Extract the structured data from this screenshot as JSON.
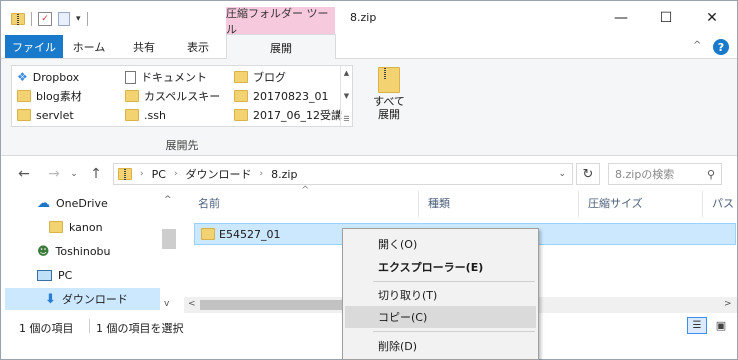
{
  "window": {
    "title": "8.zip",
    "context_tab_header": "圧縮フォルダー ツール",
    "controls": {
      "minimize": "—",
      "maximize": "☐",
      "close": "✕"
    }
  },
  "ribbon_tabs": {
    "file": "ファイル",
    "home": "ホーム",
    "share": "共有",
    "view": "表示",
    "extract": "展開"
  },
  "ribbon": {
    "destinations": [
      {
        "label": "Dropbox",
        "icon": "dropbox-icon"
      },
      {
        "label": "ドキュメント",
        "icon": "document-icon"
      },
      {
        "label": "ブログ",
        "icon": "folder-icon"
      },
      {
        "label": "blog素材",
        "icon": "folder-icon"
      },
      {
        "label": "カスペルスキー",
        "icon": "folder-icon"
      },
      {
        "label": "20170823_01",
        "icon": "folder-icon"
      },
      {
        "label": "servlet",
        "icon": "folder-icon"
      },
      {
        "label": ".ssh",
        "icon": "folder-icon"
      },
      {
        "label": "2017_06_12受講",
        "icon": "folder-icon"
      }
    ],
    "group_label": "展開先",
    "extract_all": "すべて\n展開"
  },
  "address": {
    "path": [
      "PC",
      "ダウンロード",
      "8.zip"
    ],
    "search_placeholder": "8.zipの検索"
  },
  "nav_pane": {
    "items": [
      {
        "label": "OneDrive",
        "icon": "cloud-icon"
      },
      {
        "label": "kanon",
        "icon": "folder-icon"
      },
      {
        "label": "Toshinobu",
        "icon": "user-icon"
      },
      {
        "label": "PC",
        "icon": "computer-icon"
      },
      {
        "label": "ダウンロード",
        "icon": "download-icon"
      }
    ]
  },
  "file_list": {
    "columns": [
      "名前",
      "種類",
      "圧縮サイズ",
      "パス"
    ],
    "rows": [
      {
        "name": "E54527_01"
      }
    ]
  },
  "status": {
    "count": "1 個の項目",
    "selected": "1 個の項目を選択"
  },
  "context_menu": {
    "items": [
      "開く(O)",
      "エクスプローラー(E)",
      "切り取り(T)",
      "コピー(C)",
      "削除(D)"
    ]
  },
  "colors": {
    "file_tab": "#1979ca",
    "context_tab": "#f7c9dd",
    "selection": "#cce8ff",
    "help": "#1979ca"
  }
}
